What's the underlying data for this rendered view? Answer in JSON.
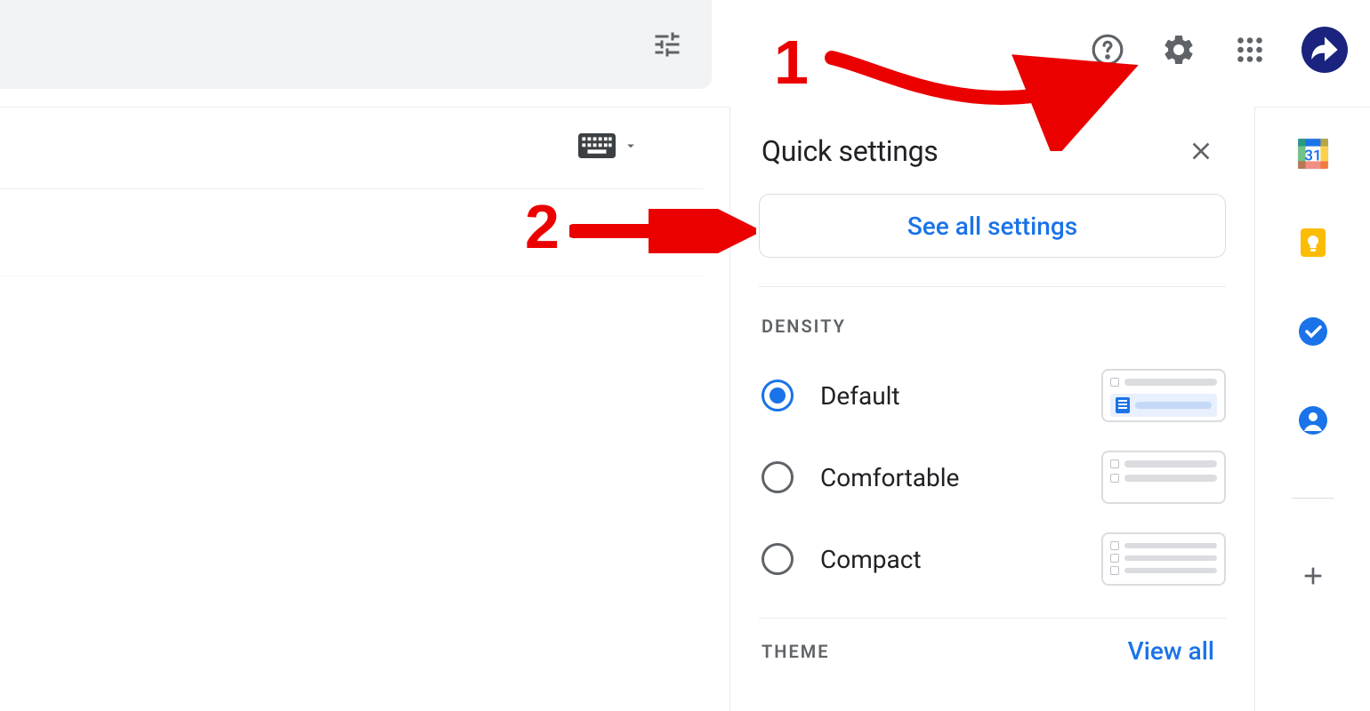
{
  "panel": {
    "title": "Quick settings",
    "see_all_label": "See all settings",
    "density_header": "DENSITY",
    "theme_header": "THEME",
    "view_all_label": "View all"
  },
  "density_options": [
    {
      "label": "Default",
      "selected": true
    },
    {
      "label": "Comfortable",
      "selected": false
    },
    {
      "label": "Compact",
      "selected": false
    }
  ],
  "annotations": {
    "step1": "1",
    "step2": "2"
  },
  "calendar_day": "31"
}
